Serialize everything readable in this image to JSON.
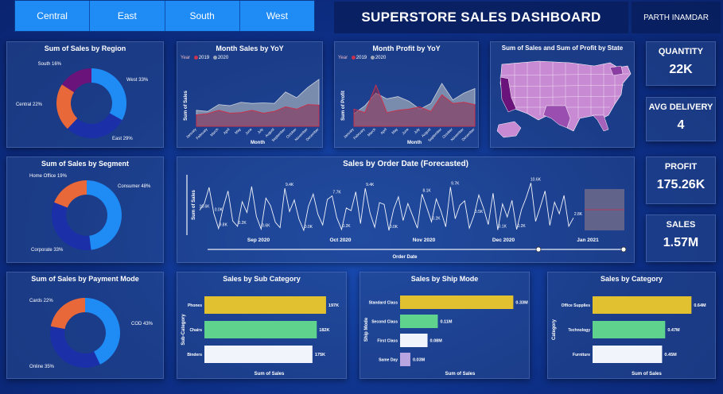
{
  "header": {
    "regions": [
      "Central",
      "East",
      "South",
      "West"
    ],
    "title": "SUPERSTORE SALES DASHBOARD",
    "author": "PARTH INAMDAR"
  },
  "kpis": [
    {
      "label": "QUANTITY",
      "value": "22K"
    },
    {
      "label": "AVG DELIVERY",
      "value": "4"
    },
    {
      "label": "PROFIT",
      "value": "175.26K"
    },
    {
      "label": "SALES",
      "value": "1.57M"
    }
  ],
  "colors": {
    "blue": "#1f8bf5",
    "orange": "#e8683a",
    "navy": "#1b2fa8",
    "purple": "#6a137a",
    "yellow": "#e2c130",
    "green": "#5fd38d",
    "white": "#f1f5fb",
    "lavender": "#b9a6e0"
  },
  "chart_data": [
    {
      "type": "pie",
      "id": "region",
      "title": "Sum of Sales by Region",
      "categories": [
        "West",
        "East",
        "Central",
        "South"
      ],
      "values": [
        33,
        29,
        22,
        16
      ],
      "labels": [
        "West 33%",
        "East 29%",
        "Central 22%",
        "South 16%"
      ]
    },
    {
      "type": "pie",
      "id": "segment",
      "title": "Sum of Sales by Segment",
      "categories": [
        "Consumer",
        "Corporate",
        "Home Office"
      ],
      "values": [
        48,
        33,
        19
      ],
      "labels": [
        "Consumer 48%",
        "Corporate 33%",
        "Home Office 19%"
      ]
    },
    {
      "type": "pie",
      "id": "payment",
      "title": "Sum of Sales by Payment Mode",
      "categories": [
        "COD",
        "Online",
        "Cards"
      ],
      "values": [
        43,
        35,
        22
      ],
      "labels": [
        "COD 43%",
        "Online 35%",
        "Cards 22%"
      ]
    },
    {
      "type": "area",
      "id": "monthsales",
      "title": "Month Sales by YoY",
      "xlabel": "Month",
      "ylabel": "Sum of Sales",
      "legend_title": "Year",
      "categories": [
        "January",
        "February",
        "March",
        "April",
        "May",
        "June",
        "July",
        "August",
        "September",
        "October",
        "November",
        "December"
      ],
      "series": [
        {
          "name": "2019",
          "values": [
            20,
            22,
            28,
            23,
            24,
            28,
            23,
            26,
            34,
            30,
            38,
            37
          ]
        },
        {
          "name": "2020",
          "values": [
            28,
            26,
            38,
            36,
            42,
            40,
            41,
            40,
            60,
            50,
            68,
            82
          ]
        }
      ],
      "ylim": [
        0,
        100
      ]
    },
    {
      "type": "area",
      "id": "monthprofit",
      "title": "Month Profit by YoY",
      "xlabel": "Month",
      "ylabel": "Sum of Profit",
      "legend_title": "Year",
      "categories": [
        "January",
        "February",
        "March",
        "April",
        "May",
        "June",
        "July",
        "August",
        "September",
        "October",
        "November",
        "December"
      ],
      "series": [
        {
          "name": "2019",
          "values": [
            30,
            24,
            72,
            24,
            28,
            30,
            34,
            26,
            55,
            40,
            42,
            38
          ]
        },
        {
          "name": "2020",
          "values": [
            22,
            36,
            58,
            48,
            52,
            44,
            30,
            40,
            75,
            46,
            58,
            66
          ]
        }
      ],
      "ylim": [
        0,
        100
      ]
    },
    {
      "type": "line",
      "id": "orderdate",
      "title": "Sales by Order Date (Forecasted)",
      "xlabel": "Order Date",
      "ylabel": "Sum of Sales",
      "tick_labels": [
        "Sep 2020",
        "Oct 2020",
        "Nov 2020",
        "Dec 2020",
        "Jan 2021"
      ],
      "data_labels": [
        "10.6K",
        "0.0K",
        "9.8K",
        "0.2K",
        "0.6K",
        "9.4K",
        "0.0K",
        "7.7K",
        "0.2K",
        "9.4K",
        "0.0K",
        "8.1K",
        "0.2K",
        "9.7K",
        "0.5K",
        "0.1K",
        "0.2K",
        "10.6K",
        "2.8K"
      ],
      "values": [
        4.5,
        6.0,
        9.6,
        3.8,
        0.4,
        5.2,
        8.8,
        2.1,
        0.9,
        6.4,
        4.0,
        9.8,
        3.1,
        0.3,
        7.2,
        5.5,
        1.8,
        0.6,
        9.4,
        4.2,
        6.8,
        2.5,
        0.0,
        5.4,
        8.1,
        3.6,
        1.2,
        6.9,
        7.7,
        2.8,
        0.2,
        5.0,
        4.4,
        8.6,
        1.5,
        9.4,
        3.9,
        0.7,
        6.2,
        5.8,
        0.0,
        4.7,
        7.5,
        2.2,
        6.0,
        3.3,
        0.5,
        8.1,
        5.1,
        1.9,
        7.0,
        4.3,
        0.8,
        9.7,
        2.6,
        5.6,
        6.6,
        0.5,
        3.4,
        7.9,
        4.9,
        1.3,
        8.3,
        0.1,
        5.9,
        3.0,
        6.7,
        0.2,
        4.6,
        7.3,
        10.6,
        2.0,
        5.3,
        8.8,
        1.1,
        6.3,
        3.7,
        7.8,
        0.9,
        2.8
      ],
      "ylim": [
        0,
        11
      ]
    },
    {
      "type": "bar",
      "id": "subcat",
      "title": "Sales by Sub Category",
      "xlabel": "Sum of Sales",
      "ylabel": "Sub-Category",
      "categories": [
        "Phones",
        "Chairs",
        "Binders"
      ],
      "values": [
        197,
        182,
        175
      ],
      "labels": [
        "197K",
        "182K",
        "175K"
      ],
      "xlim": [
        0,
        210
      ]
    },
    {
      "type": "bar",
      "id": "shipmode",
      "title": "Sales by Ship Mode",
      "xlabel": "Sum of Sales",
      "ylabel": "Ship Mode",
      "categories": [
        "Standard Class",
        "Second Class",
        "First Class",
        "Same Day"
      ],
      "values": [
        0.33,
        0.11,
        0.08,
        0.03
      ],
      "labels": [
        "0.33M",
        "0.11M",
        "0.08M",
        "0.03M"
      ],
      "xlim": [
        0,
        0.35
      ]
    },
    {
      "type": "bar",
      "id": "category",
      "title": "Sales by Category",
      "xlabel": "Sum of Sales",
      "ylabel": "Category",
      "categories": [
        "Office Supplies",
        "Technology",
        "Furniture"
      ],
      "values": [
        0.64,
        0.47,
        0.45
      ],
      "labels": [
        "0.64M",
        "0.47M",
        "0.45M"
      ],
      "xlim": [
        0,
        0.7
      ]
    },
    {
      "type": "map",
      "id": "statemap",
      "title": "Sum of Sales and Sum of Profit by State"
    }
  ]
}
